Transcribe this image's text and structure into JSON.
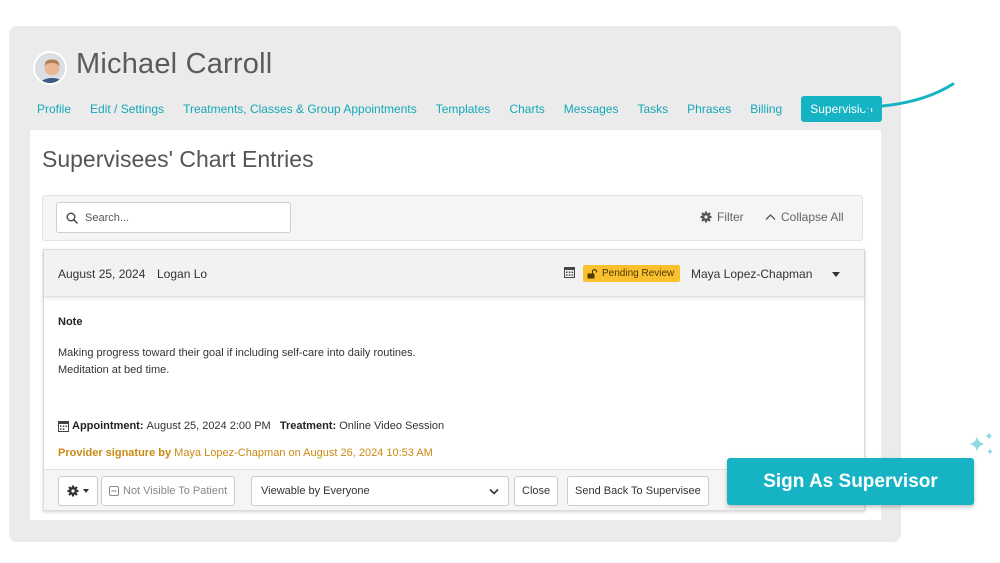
{
  "patient": {
    "name": "Michael Carroll"
  },
  "tabs": [
    {
      "label": "Profile"
    },
    {
      "label": "Edit / Settings"
    },
    {
      "label": "Treatments, Classes & Group Appointments"
    },
    {
      "label": "Templates"
    },
    {
      "label": "Charts"
    },
    {
      "label": "Messages"
    },
    {
      "label": "Tasks"
    },
    {
      "label": "Phrases"
    },
    {
      "label": "Billing"
    },
    {
      "label": "Supervision",
      "active": true
    }
  ],
  "page": {
    "title": "Supervisees' Chart Entries"
  },
  "toolbar": {
    "search_placeholder": "Search...",
    "filter_label": "Filter",
    "collapse_label": "Collapse All"
  },
  "entry": {
    "date": "August 25, 2024",
    "patient": "Logan Lo",
    "status": "Pending Review",
    "supervisor": "Maya Lopez-Chapman",
    "note_label": "Note",
    "note_lines": [
      "Making progress toward their goal if including self-care into daily routines.",
      "Meditation at bed time."
    ],
    "appointment_label": "Appointment:",
    "appointment_value": "August 25, 2024 2:00 PM",
    "treatment_label": "Treatment:",
    "treatment_value": "Online Video Session",
    "signature_prefix": "Provider signature by",
    "signature_text": "Maya Lopez-Chapman on August 26, 2024 10:53 AM"
  },
  "actions": {
    "visibility": "Not Visible To Patient",
    "viewable": "Viewable by Everyone",
    "close": "Close",
    "send_back": "Send Back To Supervisee",
    "sign": "Sign As Supervisor"
  },
  "colors": {
    "accent": "#16b3c4",
    "badge": "#fbc02d",
    "signature": "#c98a12"
  }
}
